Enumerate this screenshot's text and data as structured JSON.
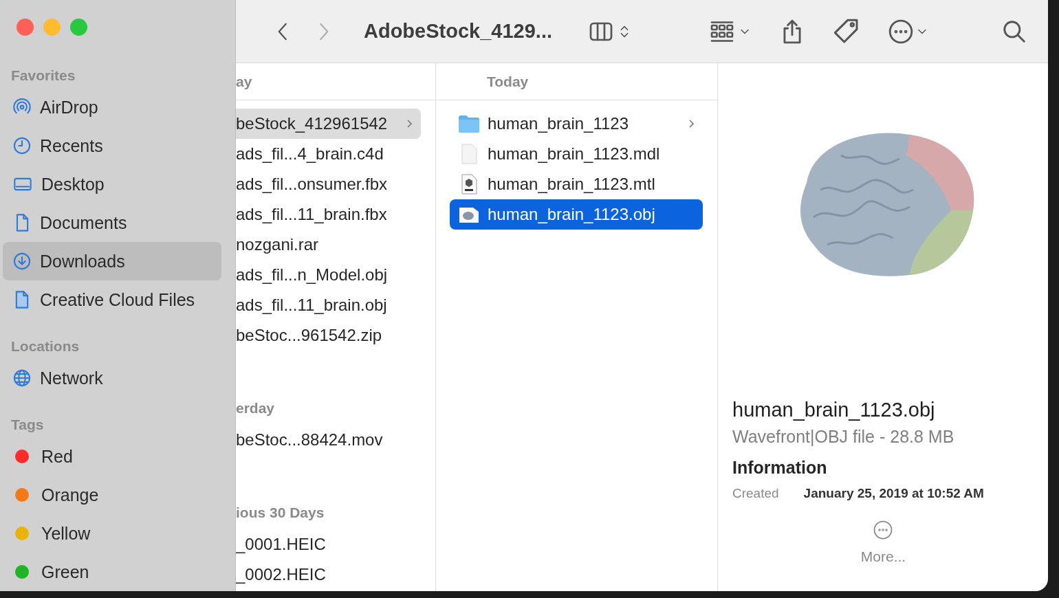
{
  "window": {
    "title": "AdobeStock_4129..."
  },
  "toolbar": {
    "nav": [
      {
        "kind": "back",
        "disabled": false
      },
      {
        "kind": "forward",
        "disabled": true
      }
    ],
    "tools": [
      {
        "kind": "columns"
      },
      {
        "kind": "group"
      },
      {
        "kind": "share"
      },
      {
        "kind": "tag"
      },
      {
        "kind": "more"
      },
      {
        "kind": "search"
      }
    ]
  },
  "sidebar": {
    "sections": [
      {
        "title": "Favorites",
        "items": [
          {
            "label": "AirDrop",
            "kind": "airdrop",
            "selected": false
          },
          {
            "label": "Recents",
            "kind": "recents",
            "selected": false
          },
          {
            "label": "Desktop",
            "kind": "desktop",
            "selected": false
          },
          {
            "label": "Documents",
            "kind": "documents",
            "selected": false
          },
          {
            "label": "Downloads",
            "kind": "downloads",
            "selected": true
          },
          {
            "label": "Creative Cloud Files",
            "kind": "file",
            "selected": false
          }
        ]
      },
      {
        "title": "Locations",
        "items": [
          {
            "label": "Network",
            "kind": "network",
            "selected": false
          }
        ]
      },
      {
        "title": "Tags",
        "items": [
          {
            "label": "Red",
            "kind": "tag",
            "color": "#fe2b2b",
            "selected": false
          },
          {
            "label": "Orange",
            "kind": "tag",
            "color": "#f57a17",
            "selected": false
          },
          {
            "label": "Yellow",
            "kind": "tag",
            "color": "#eab30b",
            "selected": false
          },
          {
            "label": "Green",
            "kind": "tag",
            "color": "#1fb425",
            "selected": false
          }
        ]
      }
    ]
  },
  "column_1": {
    "groups": [
      {
        "title": "ay",
        "items": [
          {
            "name": "beStock_412961542",
            "folder": true,
            "selected": true
          },
          {
            "name": "ads_fil...4_brain.c4d",
            "folder": false,
            "selected": false
          },
          {
            "name": "ads_fil...onsumer.fbx",
            "folder": false,
            "selected": false
          },
          {
            "name": "ads_fil...11_brain.fbx",
            "folder": false,
            "selected": false
          },
          {
            "name": "nozgani.rar",
            "folder": false,
            "selected": false
          },
          {
            "name": "ads_fil...n_Model.obj",
            "folder": false,
            "selected": false
          },
          {
            "name": "ads_fil...11_brain.obj",
            "folder": false,
            "selected": false
          },
          {
            "name": "beStoc...961542.zip",
            "folder": false,
            "selected": false
          }
        ]
      },
      {
        "title": "erday",
        "items": [
          {
            "name": "beStoc...88424.mov",
            "folder": false,
            "selected": false
          }
        ]
      },
      {
        "title": "ious 30 Days",
        "items": [
          {
            "name": "_0001.HEIC",
            "folder": false,
            "selected": false
          },
          {
            "name": "_0002.HEIC",
            "folder": false,
            "selected": false
          }
        ]
      }
    ]
  },
  "column_2": {
    "title": "Today",
    "items": [
      {
        "name": "human_brain_1123",
        "kind": "folder",
        "selected": false
      },
      {
        "name": "human_brain_1123.mdl",
        "kind": "blank",
        "selected": false
      },
      {
        "name": "human_brain_1123.mtl",
        "kind": "material",
        "selected": false
      },
      {
        "name": "human_brain_1123.obj",
        "kind": "model",
        "selected": true
      }
    ]
  },
  "preview": {
    "name": "human_brain_1123.obj",
    "subtitle": "Wavefront|OBJ file - 28.8 MB",
    "section": "Information",
    "fields": [
      {
        "label": "Created",
        "value": "January 25, 2019 at 10:52 AM"
      }
    ],
    "more": "More..."
  }
}
